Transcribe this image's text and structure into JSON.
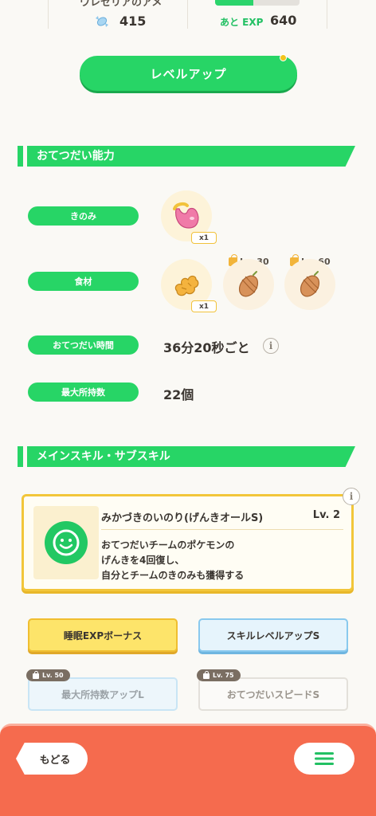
{
  "top_stats": {
    "candy_name": "ウレセリアのアメ",
    "candy_count": "415",
    "exp_label": "あと EXP",
    "exp_remaining": "640",
    "exp_progress": 0.45
  },
  "level_up": {
    "label": "レベルアップ"
  },
  "helping_section": {
    "title": "おてつだい能力",
    "berry": {
      "label": "きのみ",
      "quantity": "x1",
      "icon": "berry-icon"
    },
    "ingredients": {
      "label": "食材",
      "items": [
        {
          "icon": "ginger-icon",
          "quantity": "x1",
          "locked": false
        },
        {
          "icon": "cacao-icon",
          "lock_level": "Lv. 30",
          "locked": true
        },
        {
          "icon": "cacao-icon",
          "lock_level": "Lv. 60",
          "locked": true
        }
      ]
    },
    "help_time": {
      "label": "おてつだい時間",
      "value": "36分20秒ごと"
    },
    "max_carry": {
      "label": "最大所持数",
      "value": "22個"
    }
  },
  "skill_section": {
    "title": "メインスキル・サブスキル",
    "main_skill": {
      "name": "みかづきのいのり(げんきオールS)",
      "level": "Lv. 2",
      "description": [
        "おてつだいチームのポケモンの",
        "げんきを4回復し、",
        "自分とチームのきのみも獲得する"
      ]
    },
    "sub_skills": [
      {
        "label": "睡眠EXPボーナス",
        "style": "gold",
        "lock": ""
      },
      {
        "label": "スキルレベルアップS",
        "style": "blue",
        "lock": ""
      },
      {
        "label": "最大所持数アップL",
        "style": "blue-dim",
        "lock": "Lv. 50"
      },
      {
        "label": "おてつだいスピードS",
        "style": "white-dim",
        "lock": "Lv. 75"
      }
    ]
  },
  "bottom_bar": {
    "back_label": "もどる",
    "menu_icon": "hamburger-menu-icon"
  },
  "colors": {
    "accent_green": "#27d566",
    "bottom_bar": "#f56b4e",
    "skill_card_border": "#f2c63a"
  }
}
